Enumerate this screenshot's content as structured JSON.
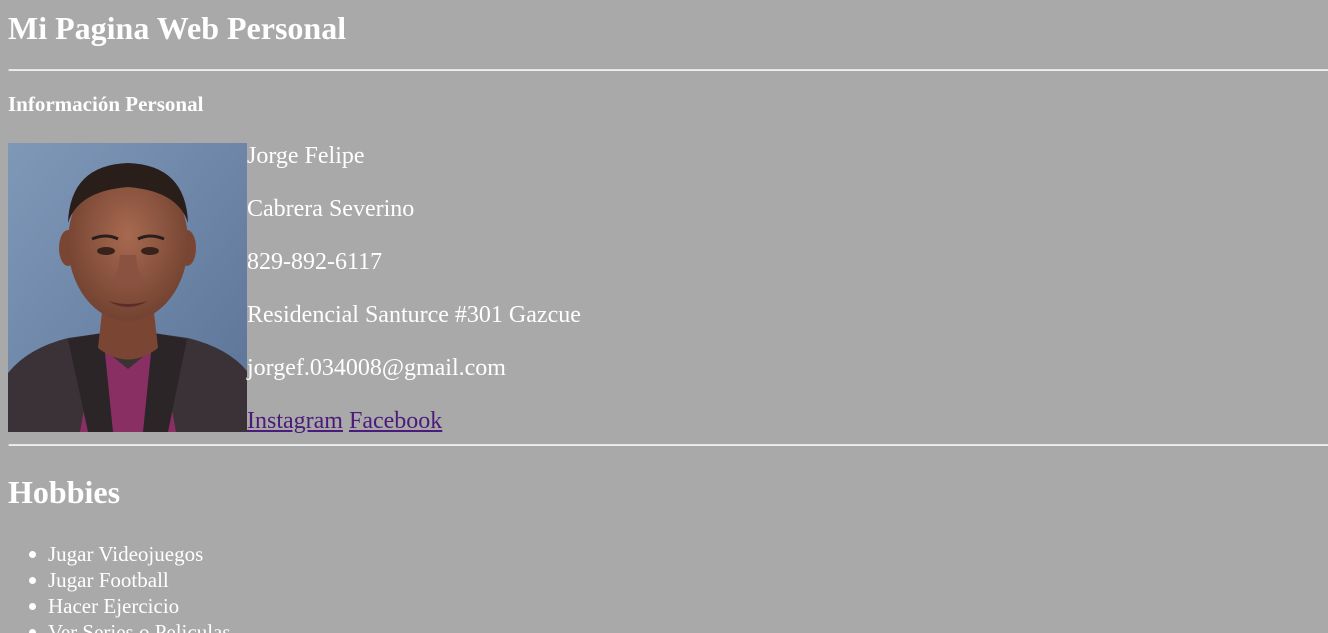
{
  "header": {
    "title": "Mi Pagina Web Personal"
  },
  "personal_info": {
    "section_title": "Información Personal",
    "photo_alt": "Foto de perfil",
    "first_name": "Jorge Felipe",
    "last_name": "Cabrera Severino",
    "phone": "829-892-6117",
    "address": "Residencial Santurce #301 Gazcue",
    "email": "jorgef.034008@gmail.com",
    "links": {
      "instagram": "Instagram",
      "facebook": "Facebook"
    }
  },
  "hobbies": {
    "title": "Hobbies",
    "items": [
      "Jugar Videojuegos",
      "Jugar Football",
      "Hacer Ejercicio",
      "Ver Series o Peliculas"
    ]
  },
  "colors": {
    "background": "#a9a9a9",
    "text": "#ffffff",
    "link": "#4b1a7a"
  }
}
